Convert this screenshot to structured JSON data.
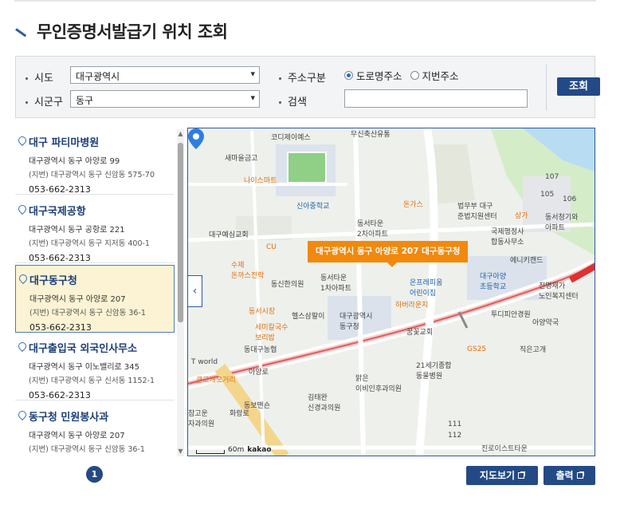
{
  "page": {
    "title": "무인증명서발급기 위치 조회"
  },
  "search": {
    "sido_label": "시도",
    "sido_value": "대구광역시",
    "sigungu_label": "시군구",
    "sigungu_value": "동구",
    "addr_type_label": "주소구분",
    "addr_options": [
      "도로명주소",
      "지번주소"
    ],
    "addr_selected": "도로명주소",
    "keyword_label": "검색",
    "keyword_value": "",
    "submit_label": "조회"
  },
  "results": [
    {
      "name": "대구 파티마병원",
      "road": "대구광역시 동구 아양로 99",
      "jibun": "(지번) 대구광역시 동구 신암동 575-70",
      "phone": "053-662-2313",
      "selected": false
    },
    {
      "name": "대구국제공항",
      "road": "대구광역시 동구 공항로 221",
      "jibun": "(지번) 대구광역시 동구 지저동 400-1",
      "phone": "053-662-2313",
      "selected": false
    },
    {
      "name": "대구동구청",
      "road": "대구광역시 동구 아양로 207",
      "jibun": "(지번) 대구광역시 동구 신암동 36-1",
      "phone": "053-662-2313",
      "selected": true
    },
    {
      "name": "대구출입국 외국인사무소",
      "road": "대구광역시 동구 이노밸리로 345",
      "jibun": "(지번) 대구광역시 동구 신서동 1152-1",
      "phone": "053-662-2313",
      "selected": false
    },
    {
      "name": "동구청 민원봉사과",
      "road": "대구광역시 동구 아양로 207",
      "jibun": "(지번) 대구광역시 동구 신암동 36-1",
      "phone": "053-662-2313",
      "selected": false
    }
  ],
  "map": {
    "callout": "대구광역시 동구 아양로 207 대구동구청",
    "scale_label": "60m",
    "provider": "kakao",
    "labels": {
      "l1": "코디제이예스",
      "l2": "무신축산유통",
      "l3": "새마을금고",
      "l4": "나이스마트",
      "l5": "신아중학교",
      "l6": "대구예심교회",
      "l7": "돈가스",
      "l8": "법무부 대구\n준법지원센터",
      "l9": "상가",
      "l10": "동서청기와\n아파트",
      "l11": "국제행정사\n합동사무소",
      "l12": "동서타운\n2차아파트",
      "l13": "CU",
      "l14": "동신한의원",
      "l15": "동서타운\n1차아파트",
      "l16": "온프레피움\n어린이집",
      "l17": "대구아양\n초등학교",
      "l18": "진명재가\n노인복지센터",
      "l19": "에니키캔드",
      "l20": "수제\n돈까스전락",
      "l21": "헬스삼팔이",
      "l22": "대구광역시\n동구청",
      "l23": "하버라운지",
      "l24": "투디피안경원",
      "l25": "아양약국",
      "l26": "동서시장",
      "l27": "세미칼국수\n보리밥",
      "l28": "꿈꽃교회",
      "l29": "동대구농협",
      "l30": "GS25",
      "l31": "직은고개",
      "l32": "21세기종합\n동물병원",
      "l33": "T world",
      "l34": "큰고개오거리",
      "l35": "맑은\n이비인후과의원",
      "l36": "동보맨숀",
      "l37": "김태완\n신경과의원",
      "l38": "진로이스트타운",
      "l39": "아양로",
      "l40": "화랑로",
      "l41": "107",
      "l42": "105",
      "l43": "106",
      "l44": "111",
      "l45": "112",
      "l46": "참고운\n자과의원"
    }
  },
  "pager": {
    "current": "1"
  },
  "footer": {
    "map_view_label": "지도보기",
    "print_label": "출력"
  },
  "colors": {
    "primary": "#244a85",
    "accent": "#f0890d",
    "selected_bg": "#fbf3d3",
    "link": "#1c3e7a"
  }
}
